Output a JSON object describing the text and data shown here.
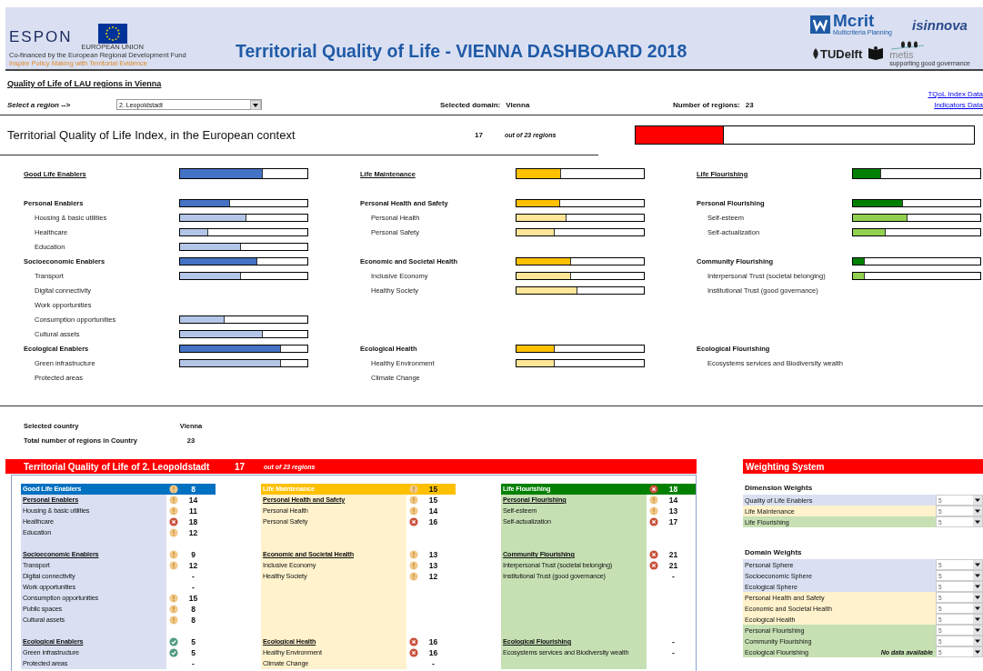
{
  "header": {
    "espon_logo": "ESPON",
    "eu_label": "EUROPEAN UNION",
    "cofinance_note": "Co-financed by the European Regional Development Fund",
    "espon_tagline": "Inspire Policy Making with Territorial Evidence",
    "title": "Territorial Quality of Life - VIENNA DASHBOARD 2018",
    "mcrit": "Mcrit",
    "mcrit_tagline": "Multicriteria Planning",
    "isinnova": "isinnova",
    "tudelft": "TUDelft",
    "metis": "metis",
    "metis_tagline": "supporting good governance"
  },
  "page_heading": "Quality of Life of LAU regions in Vienna",
  "links": [
    "TQoL Index Data",
    "Indicators Data"
  ],
  "region_select": {
    "label": "Select a region -->",
    "value": "2. Leopoldstadt"
  },
  "selected_domain": {
    "label": "Selected domain:",
    "value": "Vienna"
  },
  "region_count": {
    "label": "Number of  regions:",
    "value": "23"
  },
  "index": {
    "label": "Territorial Quality of Life Index, in the European context",
    "rank": "17",
    "of": "out of 23 regions",
    "level": 0.26
  },
  "bar_columns": [
    {
      "color": "#4472c4",
      "rows": [
        {
          "kind": "dimension",
          "label": "Good Life Enablers",
          "level": 0.65
        },
        {
          "kind": "spacer"
        },
        {
          "kind": "domain",
          "label": "Personal Enablers",
          "level": 0.39
        },
        {
          "kind": "indicator",
          "label": "Housing & basic utilities",
          "level": 0.52
        },
        {
          "kind": "indicator",
          "label": "Healthcare",
          "level": 0.22
        },
        {
          "kind": "indicator",
          "label": "Education",
          "level": 0.48
        },
        {
          "kind": "domain",
          "label": "Socioeconomic Enablers",
          "level": 0.61
        },
        {
          "kind": "indicator",
          "label": "Transport",
          "level": 0.48
        },
        {
          "kind": "indicator",
          "label": "Digital connectivity"
        },
        {
          "kind": "indicator",
          "label": "Work opportunities"
        },
        {
          "kind": "indicator",
          "label": "Consumption opportunities",
          "level": 0.35
        },
        {
          "kind": "indicator",
          "label": "Cultural assets",
          "level": 0.65
        },
        {
          "kind": "domain",
          "label": "Ecological Enablers",
          "level": 0.79
        },
        {
          "kind": "indicator",
          "label": "Green infrastructure",
          "level": 0.79
        },
        {
          "kind": "indicator",
          "label": "Protected areas"
        }
      ]
    },
    {
      "color": "#ffc000",
      "rows": [
        {
          "kind": "dimension",
          "label": "Life Maintenance",
          "level": 0.35
        },
        {
          "kind": "spacer"
        },
        {
          "kind": "domain",
          "label": "Personal Health and Safety",
          "level": 0.34
        },
        {
          "kind": "indicator",
          "label": "Personal Health",
          "level": 0.39
        },
        {
          "kind": "indicator",
          "label": "Personal Safety",
          "level": 0.3
        },
        {
          "kind": "spacer"
        },
        {
          "kind": "domain",
          "label": "Economic and Societal Health",
          "level": 0.43
        },
        {
          "kind": "indicator",
          "label": "Inclusive Economy",
          "level": 0.43
        },
        {
          "kind": "indicator",
          "label": "Healthy Society",
          "level": 0.48
        },
        {
          "kind": "spacer"
        },
        {
          "kind": "spacer"
        },
        {
          "kind": "spacer"
        },
        {
          "kind": "domain",
          "label": "Ecological Health",
          "level": 0.3
        },
        {
          "kind": "indicator",
          "label": "Healthy Environment",
          "level": 0.3
        },
        {
          "kind": "indicator",
          "label": "Climate Change"
        }
      ]
    },
    {
      "color": "#008000",
      "rows": [
        {
          "kind": "dimension",
          "label": "Life Flourishing",
          "level": 0.22
        },
        {
          "kind": "spacer"
        },
        {
          "kind": "domain",
          "label": "Personal Flourishing",
          "level": 0.39
        },
        {
          "kind": "indicator",
          "label": "Self-esteem",
          "level": 0.43
        },
        {
          "kind": "indicator",
          "label": "Self-actualization",
          "level": 0.26
        },
        {
          "kind": "spacer"
        },
        {
          "kind": "domain",
          "label": "Community Flourishing",
          "level": 0.09
        },
        {
          "kind": "indicator",
          "label": "Interpersonal Trust (societal belonging)",
          "level": 0.09
        },
        {
          "kind": "indicator",
          "label": "Institutional Trust (good governance)"
        },
        {
          "kind": "spacer"
        },
        {
          "kind": "spacer"
        },
        {
          "kind": "spacer"
        },
        {
          "kind": "domain",
          "label": "Ecological Flourishing"
        },
        {
          "kind": "indicator",
          "label": "Ecosystems services and Biodiversity wealth"
        }
      ]
    }
  ],
  "country": [
    {
      "label": "Selected country",
      "value": "Vienna"
    },
    {
      "label": "Total number of regions in Country",
      "value": "23"
    }
  ],
  "score_table": {
    "title": "Territorial Quality of Life of 2. Leopoldstadt",
    "rank": "17",
    "of": "out of 23 regions",
    "columns": [
      {
        "color": "#0070c0",
        "rows": [
          {
            "kind": "header",
            "label": "Good Life Enablers",
            "color": "#f1c98c",
            "value": "8"
          },
          {
            "kind": "domain",
            "label": "Personal Enablers",
            "color": "#f1c98c",
            "value": "14"
          },
          {
            "kind": "indicator",
            "label": "Housing & basic utilities",
            "color": "#f1c98c",
            "value": "11"
          },
          {
            "kind": "indicator",
            "label": "Healthcare",
            "color": "#c8503b",
            "value": "18"
          },
          {
            "kind": "indicator",
            "label": "Education",
            "color": "#f1c98c",
            "value": "12"
          },
          {
            "kind": "spacer"
          },
          {
            "kind": "domain",
            "label": "Socioeconomic Enablers",
            "color": "#f1c98c",
            "value": "9"
          },
          {
            "kind": "indicator",
            "label": "Transport",
            "color": "#f1c98c",
            "value": "12"
          },
          {
            "kind": "indicator",
            "label": "Digital connectivity",
            "value": "-"
          },
          {
            "kind": "indicator",
            "label": "Work opportunities",
            "value": "-"
          },
          {
            "kind": "indicator",
            "label": "Consumption opportunities",
            "color": "#f1c98c",
            "value": "15"
          },
          {
            "kind": "indicator",
            "label": "Public spaces",
            "color": "#f1c98c",
            "value": "8"
          },
          {
            "kind": "indicator",
            "label": "Cultural assets",
            "color": "#f1c98c",
            "value": "8"
          },
          {
            "kind": "spacer"
          },
          {
            "kind": "domain",
            "label": "Ecological Enablers",
            "color": "#4f9a80",
            "value": "5"
          },
          {
            "kind": "indicator",
            "label": "Green infrastructure",
            "color": "#4f9a80",
            "value": "5"
          },
          {
            "kind": "indicator",
            "label": "Protected areas",
            "value": "-"
          }
        ]
      },
      {
        "color": "#ffc000",
        "rows": [
          {
            "kind": "header",
            "label": "Life Maintenance",
            "color": "#f1c98c",
            "value": "15"
          },
          {
            "kind": "domain",
            "label": "Personal Health and Safety",
            "color": "#f1c98c",
            "value": "15"
          },
          {
            "kind": "indicator",
            "label": "Personal Health",
            "color": "#f1c98c",
            "value": "14"
          },
          {
            "kind": "indicator",
            "label": "Personal Safety",
            "color": "#c8503b",
            "value": "16"
          },
          {
            "kind": "spacer"
          },
          {
            "kind": "spacer"
          },
          {
            "kind": "domain",
            "label": "Economic and Societal Health",
            "color": "#f1c98c",
            "value": "13"
          },
          {
            "kind": "indicator",
            "label": "Inclusive Economy",
            "color": "#f1c98c",
            "value": "13"
          },
          {
            "kind": "indicator",
            "label": "Healthy Society",
            "color": "#f1c98c",
            "value": "12"
          },
          {
            "kind": "spacer"
          },
          {
            "kind": "spacer"
          },
          {
            "kind": "spacer"
          },
          {
            "kind": "spacer"
          },
          {
            "kind": "spacer"
          },
          {
            "kind": "domain",
            "label": "Ecological Health",
            "color": "#c8503b",
            "value": "16"
          },
          {
            "kind": "indicator",
            "label": "Healthy Environment",
            "color": "#c8503b",
            "value": "16"
          },
          {
            "kind": "indicator",
            "label": "Climate Change",
            "value": "-"
          }
        ]
      },
      {
        "color": "#008000",
        "rows": [
          {
            "kind": "header",
            "label": "Life Flourishing",
            "color": "#c8503b",
            "value": "18"
          },
          {
            "kind": "domain",
            "label": "Personal Flourishing",
            "color": "#f1c98c",
            "value": "14"
          },
          {
            "kind": "indicator",
            "label": "Self-esteem",
            "color": "#f1c98c",
            "value": "13"
          },
          {
            "kind": "indicator",
            "label": "Self-actualization",
            "color": "#c8503b",
            "value": "17"
          },
          {
            "kind": "spacer"
          },
          {
            "kind": "spacer"
          },
          {
            "kind": "domain",
            "label": "Community Flourishing",
            "color": "#c8503b",
            "value": "21"
          },
          {
            "kind": "indicator",
            "label": "Interpersonal Trust (societal belonging)",
            "color": "#c8503b",
            "value": "21"
          },
          {
            "kind": "indicator",
            "label": "Institutional Trust (good governance)",
            "value": "-"
          },
          {
            "kind": "spacer"
          },
          {
            "kind": "spacer"
          },
          {
            "kind": "spacer"
          },
          {
            "kind": "spacer"
          },
          {
            "kind": "spacer"
          },
          {
            "kind": "domain",
            "label": "Ecological Flourishing",
            "value": "-"
          },
          {
            "kind": "indicator",
            "label": "Ecosystems services and Biodiversity wealth",
            "value": "-"
          },
          {
            "kind": "spacer"
          }
        ]
      }
    ]
  },
  "weighting": {
    "title": "Weighting System",
    "groups": [
      {
        "title": "Dimension Weights",
        "rows": [
          {
            "label": "Quality of Life Enablers",
            "value": "5",
            "color": "#dae0f2"
          },
          {
            "label": "Life Maintenance",
            "value": "5",
            "color": "#fff2cc"
          },
          {
            "label": "Life Flourishing",
            "value": "5",
            "color": "#c6e0b4"
          }
        ]
      },
      {
        "title": "Domain Weights",
        "rows": [
          {
            "label": "Personal Sphere",
            "value": "5",
            "color": "#dae0f2"
          },
          {
            "label": "Socioeconomic Sphere",
            "value": "5",
            "color": "#dae0f2"
          },
          {
            "label": "Ecological Sphere",
            "value": "5",
            "color": "#dae0f2"
          },
          {
            "label": "Personal Health and Safety",
            "value": "5",
            "color": "#fff2cc"
          },
          {
            "label": "Economic and Societal Health",
            "value": "5",
            "color": "#fff2cc"
          },
          {
            "label": "Ecological Health",
            "value": "5",
            "color": "#fff2cc"
          },
          {
            "label": "Personal Flourishing",
            "value": "5",
            "color": "#c6e0b4"
          },
          {
            "label": "Community Flourishing",
            "value": "5",
            "color": "#c6e0b4"
          },
          {
            "label": "Ecological Flourishing",
            "value": "5",
            "color": "#c6e0b4",
            "note": "No data available"
          }
        ]
      }
    ]
  }
}
